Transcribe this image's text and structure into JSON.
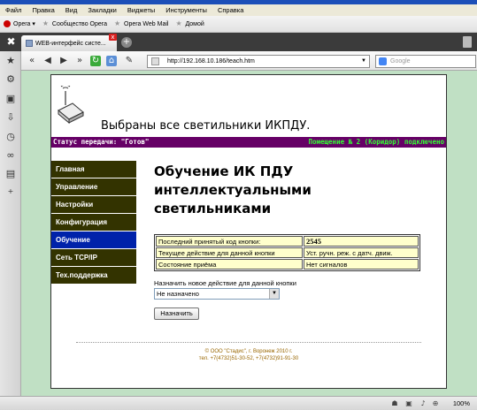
{
  "menu": [
    "Файл",
    "Правка",
    "Вид",
    "Закладки",
    "Виджеты",
    "Инструменты",
    "Справка"
  ],
  "bookmarks": [
    {
      "label": "Opera ▾",
      "icon": "opera-icon"
    },
    {
      "label": "Сообщество Opera",
      "icon": "star-icon"
    },
    {
      "label": "Opera Web Mail",
      "icon": "star-icon"
    },
    {
      "label": "Домой",
      "icon": "star-icon"
    }
  ],
  "tab": {
    "title": "WEB-интерфейс систе...",
    "close": "x",
    "new": "+"
  },
  "address": {
    "url": "http://192.168.10.186/teach.htm",
    "search_placeholder": "Google"
  },
  "page": {
    "title": "Выбраны все светильники ИКПДУ.",
    "status_left": "Статус передачи: \"Готов\"",
    "status_right": "Помещение № 2 (Коридор) подключено",
    "nav": [
      "Главная",
      "Управление",
      "Настройки",
      "Конфигурация",
      "Обучение",
      "Сеть TCP/IP",
      "Тех.поддержка"
    ],
    "active_nav": 4,
    "heading_lines": [
      "Обучение ИК ПДУ",
      "интеллектуальными",
      "светильниками"
    ],
    "table": [
      [
        "Последний принятый код кнопки:",
        "2545"
      ],
      [
        "Текущее действие для данной кнопки",
        "Уст. ручн. реж. с датч. движ."
      ],
      [
        "Состояние приёма",
        "Нет сигналов"
      ]
    ],
    "assign_label": "Назначить новое действие для данной кнопки",
    "select_value": "Не назначено",
    "button_label": "Назначить",
    "footer_line1": "© ООО \"Стадис\", г. Воронеж 2010 г.",
    "footer_line2": "тел. +7(4732)51-30-52, +7(4732)91-91-30"
  },
  "statusbar": {
    "zoom": "100%"
  }
}
